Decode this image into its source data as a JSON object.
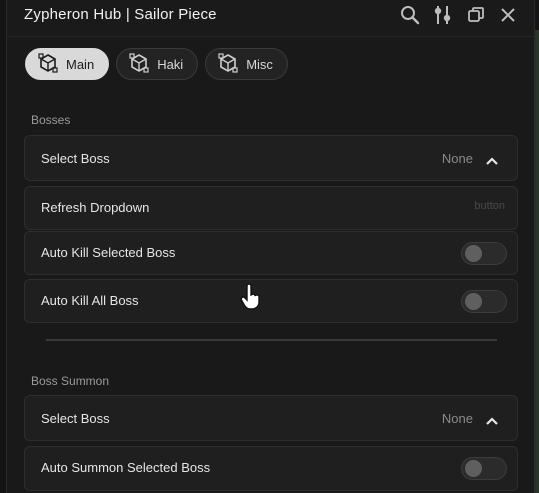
{
  "window": {
    "title": "Zypheron Hub | Sailor Piece",
    "icons": [
      "search-icon",
      "settings-sliders-icon",
      "copy-window-icon",
      "close-icon"
    ]
  },
  "tabs": [
    {
      "label": "Main",
      "icon": "cube-icon",
      "active": true
    },
    {
      "label": "Haki",
      "icon": "cube-icon",
      "active": false
    },
    {
      "label": "Misc",
      "icon": "cube-icon",
      "active": false
    }
  ],
  "bosses": {
    "section_title": "Bosses",
    "select_boss": {
      "label": "Select Boss",
      "value": "None"
    },
    "refresh": {
      "label": "Refresh Dropdown",
      "hint": "button"
    },
    "auto_kill_selected": {
      "label": "Auto Kill Selected Boss",
      "enabled": false
    },
    "auto_kill_all": {
      "label": "Auto Kill All Boss",
      "enabled": false
    }
  },
  "boss_summon": {
    "section_title": "Boss Summon",
    "select_boss": {
      "label": "Select Boss",
      "value": "None"
    },
    "auto_summon_selected": {
      "label": "Auto Summon Selected Boss",
      "enabled": false
    }
  }
}
